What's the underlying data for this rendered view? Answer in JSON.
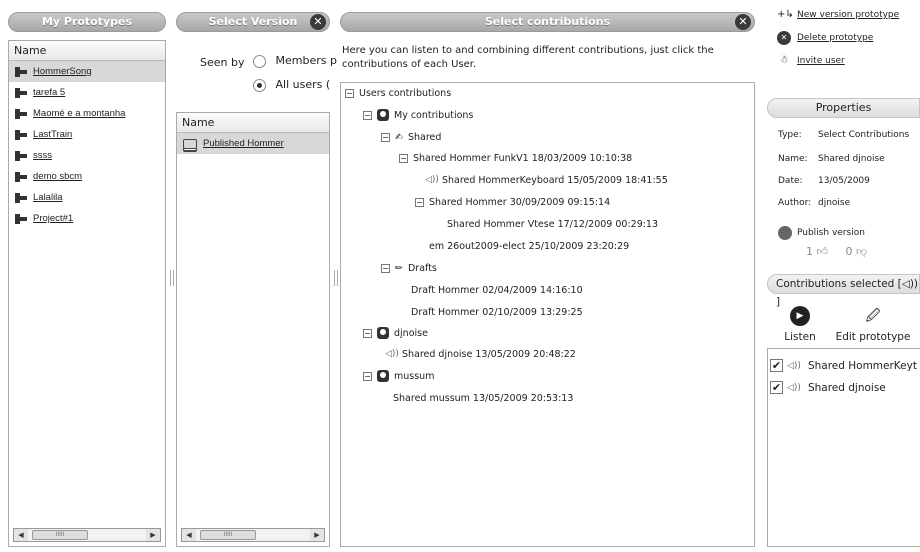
{
  "headers": {
    "prototypes": "My Prototypes",
    "version": "Select Version",
    "contributions": "Select contributions"
  },
  "prototypes": {
    "column": "Name",
    "items": [
      "HommerSong",
      "tarefa 5",
      "Maomé e a montanha",
      "LastTrain",
      "ssss",
      "demo sbcm",
      "Lalalila",
      "Project#1"
    ],
    "selected_index": 0
  },
  "version": {
    "seen_by_label": "Seen by",
    "options": [
      "Members p",
      "All users  ("
    ],
    "selected_option": 1,
    "column": "Name",
    "items": [
      "Published Hommer"
    ]
  },
  "contributions": {
    "intro": "Here you can listen to and combining different contributions, just click the contributions of each User.",
    "root": "Users contributions",
    "my_contributions": "My contributions",
    "shared": "Shared",
    "shared_items": [
      "Shared Hommer FunkV1  18/03/2009  10:10:38",
      "Shared HommerKeyboard  15/05/2009  18:41:55",
      "Shared Hommer  30/09/2009  09:15:14",
      "Shared Hommer Vtese  17/12/2009  00:29:13",
      "em 26out2009-elect  25/10/2009  23:20:29"
    ],
    "drafts": "Drafts",
    "draft_items": [
      "Draft Hommer  02/04/2009  14:16:10",
      "Draft Hommer  02/10/2009  13:29:25"
    ],
    "user1": "djnoise",
    "user1_item": "Shared djnoise  13/05/2009  20:48:22",
    "user2": "mussum",
    "user2_item": "Shared mussum  13/05/2009  20:53:13"
  },
  "actions": {
    "new_version": "New version prototype",
    "delete": "Delete prototype",
    "invite": "Invite user"
  },
  "properties": {
    "title": "Properties",
    "type_label": "Type:",
    "type_value": "Select Contributions",
    "name_label": "Name:",
    "name_value": "Shared djnoise",
    "date_label": "Date:",
    "date_value": "13/05/2009",
    "author_label": "Author:",
    "author_value": "djnoise",
    "publish_label": "Publish version",
    "likes": "1",
    "dislikes": "0"
  },
  "selected": {
    "title": "Contributions selected  [◁))  ]",
    "listen": "Listen",
    "edit": "Edit prototype",
    "items": [
      "Shared HommerKeyt",
      "Shared djnoise"
    ]
  }
}
